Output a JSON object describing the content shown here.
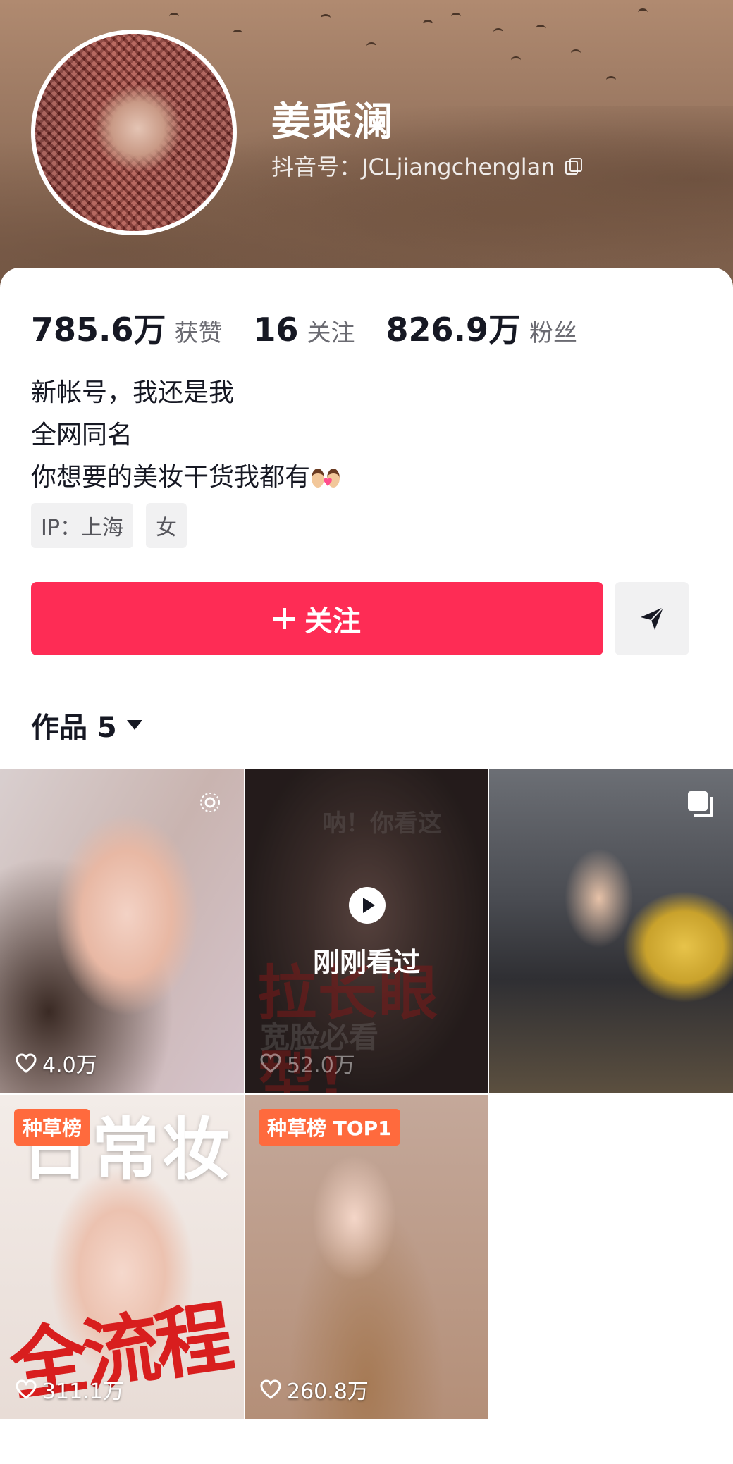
{
  "profile": {
    "name": "姜乘澜",
    "douyin_id": "抖音号：JCLjiangchenglan"
  },
  "stats": [
    {
      "value": "785.6万",
      "label": "获赞"
    },
    {
      "value": "16",
      "label": "关注"
    },
    {
      "value": "826.9万",
      "label": "粉丝"
    }
  ],
  "bio": {
    "line1": "新帐号，我还是我",
    "line2": "全网同名",
    "line3": "你想要的美妆干货我都有"
  },
  "tags": [
    "IP：上海",
    "女"
  ],
  "actions": {
    "follow_label": "关注"
  },
  "works_tab": {
    "label": "作品 5"
  },
  "videos": [
    {
      "likes": "4.0万"
    },
    {
      "likes": "52.0万",
      "top_text": "呐！你看这",
      "big_text": "拉长眼型!",
      "sub_text": "宽脸必看",
      "status": "刚刚看过"
    },
    {
      "likes": ""
    },
    {
      "likes": "311.1万",
      "badge": "种草榜",
      "title": "日常妆",
      "red_text": "全流程"
    },
    {
      "likes": "260.8万",
      "badge": "种草榜 TOP1"
    }
  ],
  "colors": {
    "accent": "#fe2c55",
    "badge": "#ff6a3d"
  },
  "icons": {
    "copy": "copy-icon",
    "plus": "plus-icon",
    "send": "send-icon",
    "caret": "caret-down-icon",
    "heart": "heart-icon",
    "play": "play-icon",
    "live": "live-icon",
    "multi": "multi-image-icon"
  }
}
